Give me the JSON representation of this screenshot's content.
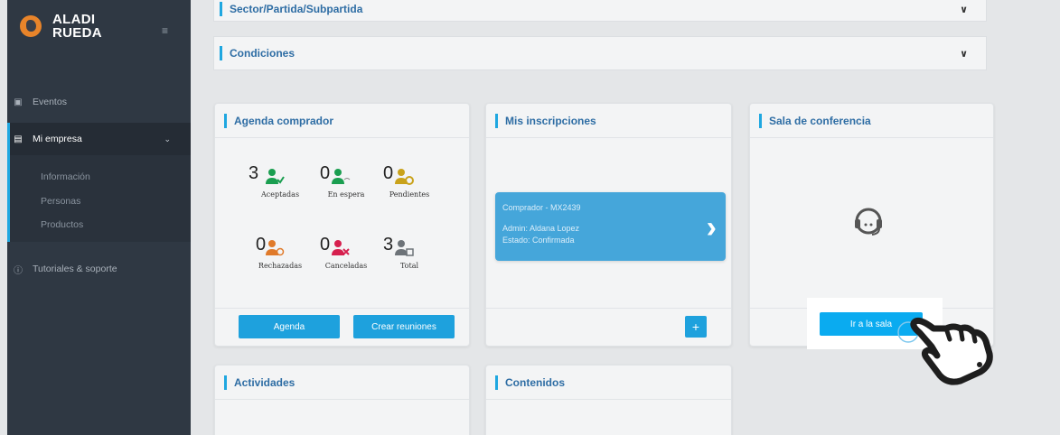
{
  "brand": {
    "line1": "ALADI",
    "line2": "RUEDA"
  },
  "sidebar": {
    "items": [
      {
        "label": "Eventos",
        "icon": "calendar-icon"
      },
      {
        "label": "Mi empresa",
        "icon": "briefcase-icon",
        "active": true
      },
      {
        "label": "Tutoriales & soporte",
        "icon": "help-circle-icon"
      }
    ],
    "submenu": [
      "Información",
      "Personas",
      "Productos"
    ]
  },
  "accordions": {
    "sector": "Sector/Partida/Subpartida",
    "condiciones": "Condiciones"
  },
  "agenda": {
    "title": "Agenda comprador",
    "stats": [
      {
        "count": "3",
        "label": "Aceptadas",
        "color": "#1a9e50",
        "badge": "check-icon"
      },
      {
        "count": "0",
        "label": "En espera",
        "color": "#1a9e50",
        "badge": "wait-icon"
      },
      {
        "count": "0",
        "label": "Pendientes",
        "color": "#c9a21a",
        "badge": "clock-icon"
      },
      {
        "count": "0",
        "label": "Rechazadas",
        "color": "#e07a2a",
        "badge": "block-icon"
      },
      {
        "count": "0",
        "label": "Canceladas",
        "color": "#d61f4e",
        "badge": "x-icon"
      },
      {
        "count": "3",
        "label": "Total",
        "color": "#6d7378",
        "badge": "calendar-icon"
      }
    ],
    "buttons": {
      "agenda": "Agenda",
      "crear": "Crear reuniones"
    }
  },
  "inscripciones": {
    "title": "Mis inscripciones",
    "card": {
      "heading": "Comprador - MX2439",
      "admin": "Admin: Aldana Lopez",
      "estado": "Estado: Confirmada"
    },
    "add_label": "+"
  },
  "sala": {
    "title": "Sala de conferencia",
    "button": "Ir a la sala"
  },
  "actividades": {
    "title": "Actividades"
  },
  "contenidos": {
    "title": "Contenidos"
  },
  "colors": {
    "accent": "#1fa7e0",
    "sidebar": "#2f3843",
    "title": "#2e6da4"
  }
}
